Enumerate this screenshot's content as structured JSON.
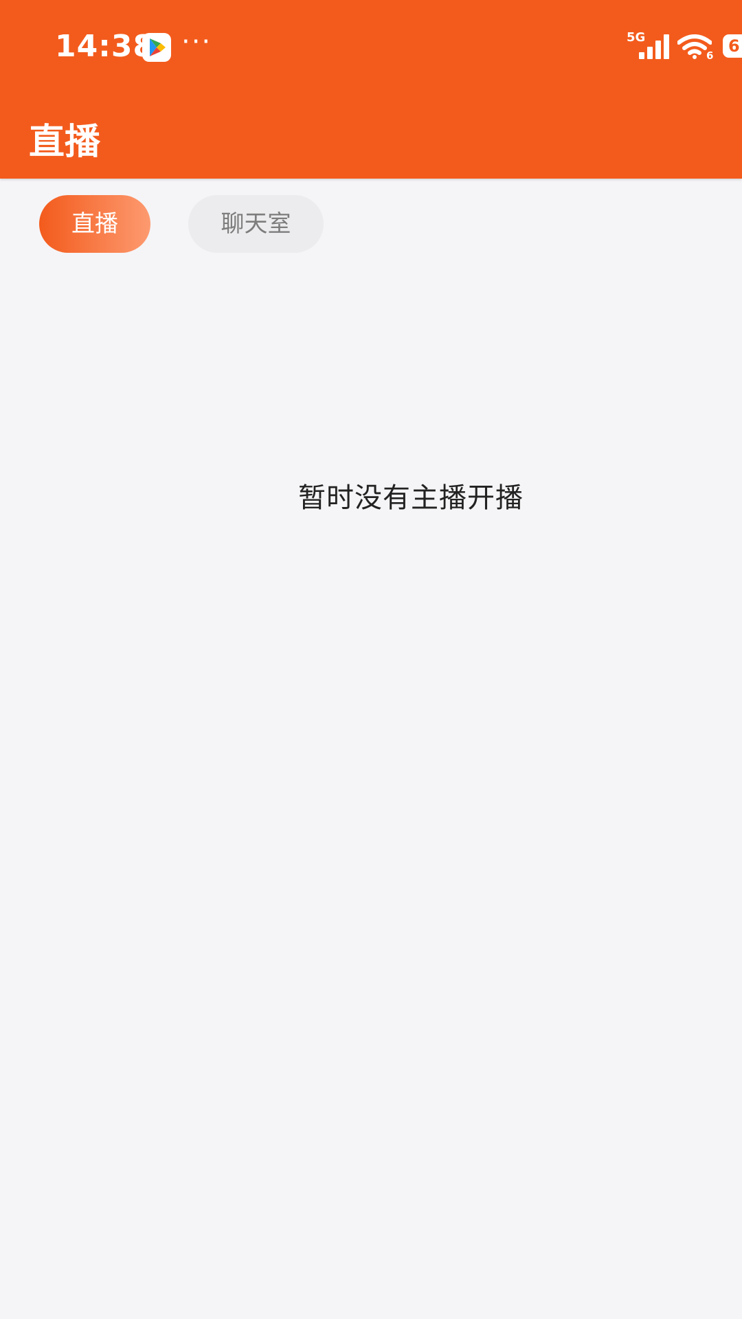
{
  "status_bar": {
    "time": "14:38",
    "more": "···",
    "network": "5G",
    "wifi_level": "6",
    "battery": "6"
  },
  "app_bar": {
    "title": "直播"
  },
  "tabs": [
    {
      "label": "直播",
      "selected": true
    },
    {
      "label": "聊天室",
      "selected": false
    }
  ],
  "content": {
    "empty_message": "暂时没有主播开播"
  },
  "colors": {
    "accent": "#f35b1c",
    "background": "#f5f5f7",
    "tab_inactive": "#ececee"
  }
}
